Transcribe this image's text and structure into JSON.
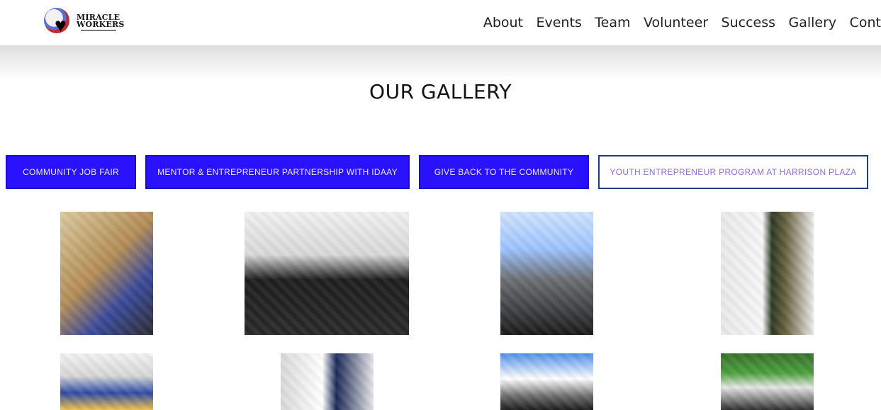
{
  "header": {
    "logo": {
      "line1": "MIRACLE",
      "line2": "WORKERS"
    },
    "nav": [
      "About",
      "Events",
      "Team",
      "Volunteer",
      "Success",
      "Gallery",
      "Cont"
    ]
  },
  "page": {
    "title": "OUR GALLERY"
  },
  "filters": [
    {
      "label": "COMMUNITY JOB FAIR",
      "active": false
    },
    {
      "label": "MENTOR & ENTREPRENEUR PARTNERSHIP WITH IDAAY",
      "active": false
    },
    {
      "label": "GIVE BACK TO THE COMMUNITY",
      "active": false
    },
    {
      "label": "YOUTH ENTREPRENEUR PROGRAM AT HARRISON PLAZA",
      "active": true
    }
  ],
  "colors": {
    "accent": "#2b12ff",
    "active_border": "#233a8a",
    "active_text": "#8a6fd8"
  }
}
